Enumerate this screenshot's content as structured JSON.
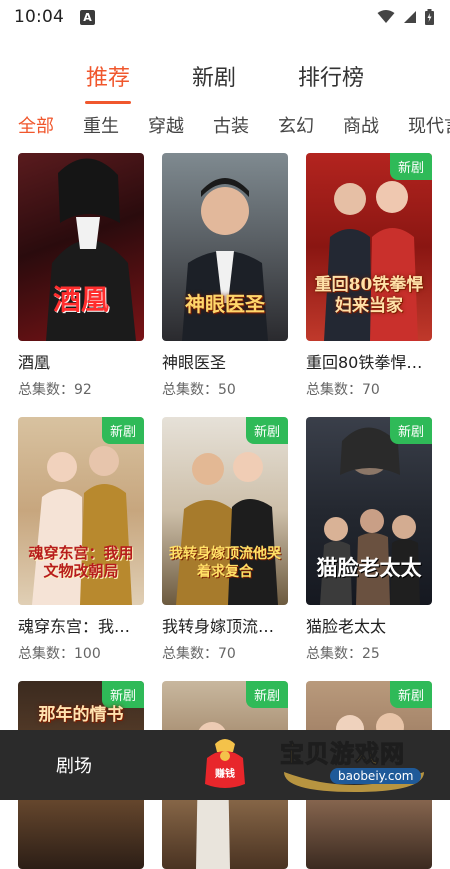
{
  "status": {
    "time": "10:04",
    "notif_letter": "A"
  },
  "tabs": [
    {
      "label": "推荐",
      "active": true
    },
    {
      "label": "新剧",
      "active": false
    },
    {
      "label": "排行榜",
      "active": false
    }
  ],
  "categories": [
    "全部",
    "重生",
    "穿越",
    "古装",
    "玄幻",
    "商战",
    "现代言情"
  ],
  "badge_new": "新剧",
  "cards": [
    {
      "title": "酒凰",
      "meta": "总集数：92",
      "poster_text": "酒凰",
      "new": false
    },
    {
      "title": "神眼医圣",
      "meta": "总集数：50",
      "poster_text": "神眼医圣",
      "new": false
    },
    {
      "title": "重回80铁拳悍妇来当家",
      "meta": "总集数：70",
      "poster_text": "重回80铁拳悍妇来当家",
      "new": true
    },
    {
      "title": "魂穿东宫：我用文物改朝局",
      "meta": "总集数：100",
      "poster_text": "魂穿东宫：我用文物改朝局",
      "new": true
    },
    {
      "title": "我转身嫁顶流他哭着求复合",
      "meta": "总集数：70",
      "poster_text": "我转身嫁顶流他哭着求复合",
      "new": true
    },
    {
      "title": "猫脸老太太",
      "meta": "总集数：25",
      "poster_text": "猫脸老太太",
      "new": true
    },
    {
      "title": "",
      "meta": "",
      "poster_text": "那年的情书",
      "new": true
    },
    {
      "title": "",
      "meta": "",
      "poster_text": "",
      "new": true
    },
    {
      "title": "",
      "meta": "",
      "poster_text": "",
      "new": true
    }
  ],
  "bottom_nav": {
    "theater": "剧场",
    "earn": "赚钱"
  },
  "watermark": {
    "name": "宝贝游戏网",
    "domain": "baobeiy.com"
  }
}
